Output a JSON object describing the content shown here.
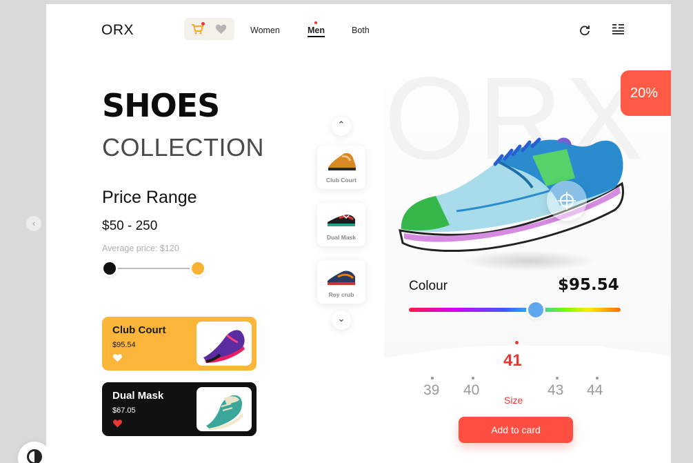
{
  "header": {
    "logo": "ORX",
    "nav": [
      "Women",
      "Men",
      "Both"
    ],
    "active_nav": "Men",
    "icons": [
      "cart-icon",
      "heart-icon",
      "refresh-icon",
      "menu-icon"
    ]
  },
  "hero": {
    "title": "SHOES",
    "subtitle": "COLLECTION"
  },
  "price": {
    "heading": "Price Range",
    "range": "$50 - 250",
    "average": "Average price: $120"
  },
  "cards": [
    {
      "name": "Club Court",
      "price": "$95.54",
      "color": "#fbb63a",
      "liked": false
    },
    {
      "name": "Dual Mask",
      "price": "$67.05",
      "color": "#111111",
      "liked": true
    }
  ],
  "rail": {
    "items": [
      {
        "label": "Club Court"
      },
      {
        "label": "Dual Mask"
      },
      {
        "label": "Roy crub"
      }
    ]
  },
  "product": {
    "watermark": "ORX",
    "discount": "20%",
    "colour_label": "Colour",
    "price": "$95.54",
    "colour_position": 0.6
  },
  "sizes": {
    "options": [
      "39",
      "40",
      "41",
      "43",
      "44"
    ],
    "selected": "41",
    "label": "Size"
  },
  "actions": {
    "add_label": "Add to card"
  },
  "colors": {
    "accent": "#ff4f42",
    "yellow": "#fbb63a",
    "dark": "#111111",
    "red": "#e53935"
  }
}
